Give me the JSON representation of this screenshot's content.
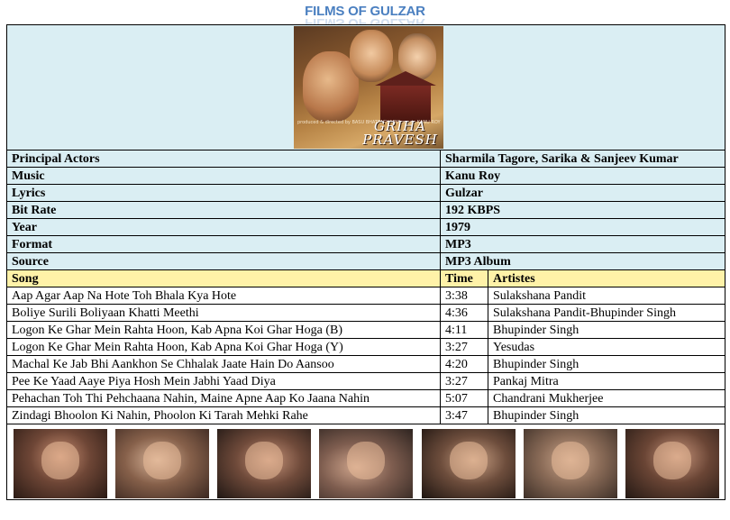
{
  "header": {
    "title": "FILMS OF GULZAR"
  },
  "poster": {
    "title_line1": "GRIHA",
    "title_line2": "PRAVESH",
    "credits": "produced & directed by BASU BHATTACHARYA music KANU ROY"
  },
  "info_rows": [
    {
      "label": "Principal Actors",
      "value": "Sharmila Tagore, Sarika & Sanjeev Kumar"
    },
    {
      "label": "Music",
      "value": "Kanu Roy"
    },
    {
      "label": "Lyrics",
      "value": "Gulzar"
    },
    {
      "label": "Bit Rate",
      "value": "192 KBPS"
    },
    {
      "label": "Year",
      "value": "1979"
    },
    {
      "label": "Format",
      "value": "MP3"
    },
    {
      "label": "Source",
      "value": "MP3 Album"
    }
  ],
  "songs_header": {
    "song": "Song",
    "time": "Time",
    "artistes": "Artistes"
  },
  "songs": [
    {
      "song": "Aap Agar Aap Na Hote Toh Bhala Kya Hote",
      "time": "3:38",
      "artistes": "Sulakshana Pandit"
    },
    {
      "song": "Boliye Surili Boliyaan Khatti Meethi",
      "time": "4:36",
      "artistes": "Sulakshana Pandit-Bhupinder Singh"
    },
    {
      "song": "Logon Ke Ghar Mein Rahta Hoon, Kab Apna Koi Ghar Hoga (B)",
      "time": "4:11",
      "artistes": "Bhupinder Singh"
    },
    {
      "song": "Logon Ke Ghar Mein Rahta Hoon, Kab Apna Koi Ghar Hoga (Y)",
      "time": "3:27",
      "artistes": "Yesudas"
    },
    {
      "song": "Machal Ke Jab Bhi Aankhon Se Chhalak Jaate Hain Do Aansoo",
      "time": "4:20",
      "artistes": "Bhupinder Singh"
    },
    {
      "song": "Pee Ke Yaad Aaye Piya Hosh Mein Jabhi Yaad Diya",
      "time": "3:27",
      "artistes": "Pankaj Mitra"
    },
    {
      "song": "Pehachan Toh Thi Pehchaana Nahin, Maine Apne Aap Ko Jaana Nahin",
      "time": "5:07",
      "artistes": "Chandrani Mukherjee"
    },
    {
      "song": "Zindagi Bhoolon Ki Nahin, Phoolon Ki Tarah Mehki Rahe",
      "time": "3:47",
      "artistes": "Bhupinder Singh"
    }
  ]
}
